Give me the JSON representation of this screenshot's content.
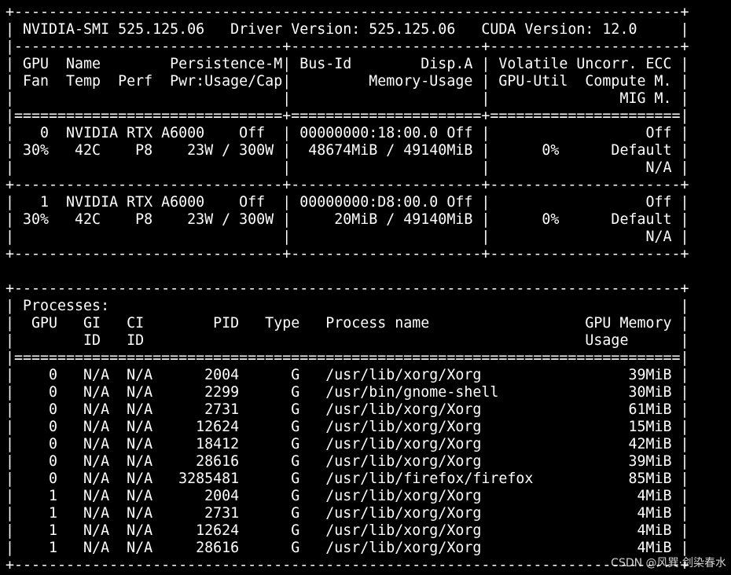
{
  "terminal": {
    "lines": [
      "+-----------------------------------------------------------------------------+",
      "| NVIDIA-SMI 525.125.06   Driver Version: 525.125.06   CUDA Version: 12.0     |",
      "|-------------------------------+----------------------+----------------------+",
      "| GPU  Name        Persistence-M| Bus-Id        Disp.A | Volatile Uncorr. ECC |",
      "| Fan  Temp  Perf  Pwr:Usage/Cap|         Memory-Usage | GPU-Util  Compute M. |",
      "|                               |                      |               MIG M. |",
      "|===============================+======================+======================|",
      "|   0  NVIDIA RTX A6000    Off  | 00000000:18:00.0 Off |                  Off |",
      "| 30%   42C    P8    23W / 300W |  48674MiB / 49140MiB |      0%      Default |",
      "|                               |                      |                  N/A |",
      "+-------------------------------+----------------------+----------------------+",
      "|   1  NVIDIA RTX A6000    Off  | 00000000:D8:00.0 Off |                  Off |",
      "| 30%   42C    P8    23W / 300W |     20MiB / 49140MiB |      0%      Default |",
      "|                               |                      |                  N/A |",
      "+-------------------------------+----------------------+----------------------+",
      "",
      "+-----------------------------------------------------------------------------+",
      "| Processes:                                                                  |",
      "|  GPU   GI   CI        PID   Type   Process name                  GPU Memory |",
      "|        ID   ID                                                   Usage      |",
      "|=============================================================================|",
      "|    0   N/A  N/A      2004      G   /usr/lib/xorg/Xorg                 39MiB |",
      "|    0   N/A  N/A      2299      G   /usr/bin/gnome-shell               30MiB |",
      "|    0   N/A  N/A      2731      G   /usr/lib/xorg/Xorg                 61MiB |",
      "|    0   N/A  N/A     12624      G   /usr/lib/xorg/Xorg                 15MiB |",
      "|    0   N/A  N/A     18412      G   /usr/lib/xorg/Xorg                 42MiB |",
      "|    0   N/A  N/A     28616      G   /usr/lib/xorg/Xorg                 39MiB |",
      "|    0   N/A  N/A   3285481      G   /usr/lib/firefox/firefox           85MiB |",
      "|    1   N/A  N/A      2004      G   /usr/lib/xorg/Xorg                  4MiB |",
      "|    1   N/A  N/A      2731      G   /usr/lib/xorg/Xorg                  4MiB |",
      "|    1   N/A  N/A     12624      G   /usr/lib/xorg/Xorg                  4MiB |",
      "|    1   N/A  N/A     28616      G   /usr/lib/xorg/Xorg                  4MiB |",
      "+-----------------------------------------------------------------------------+"
    ]
  },
  "watermark": "CSDN @风巽·剑染春水"
}
